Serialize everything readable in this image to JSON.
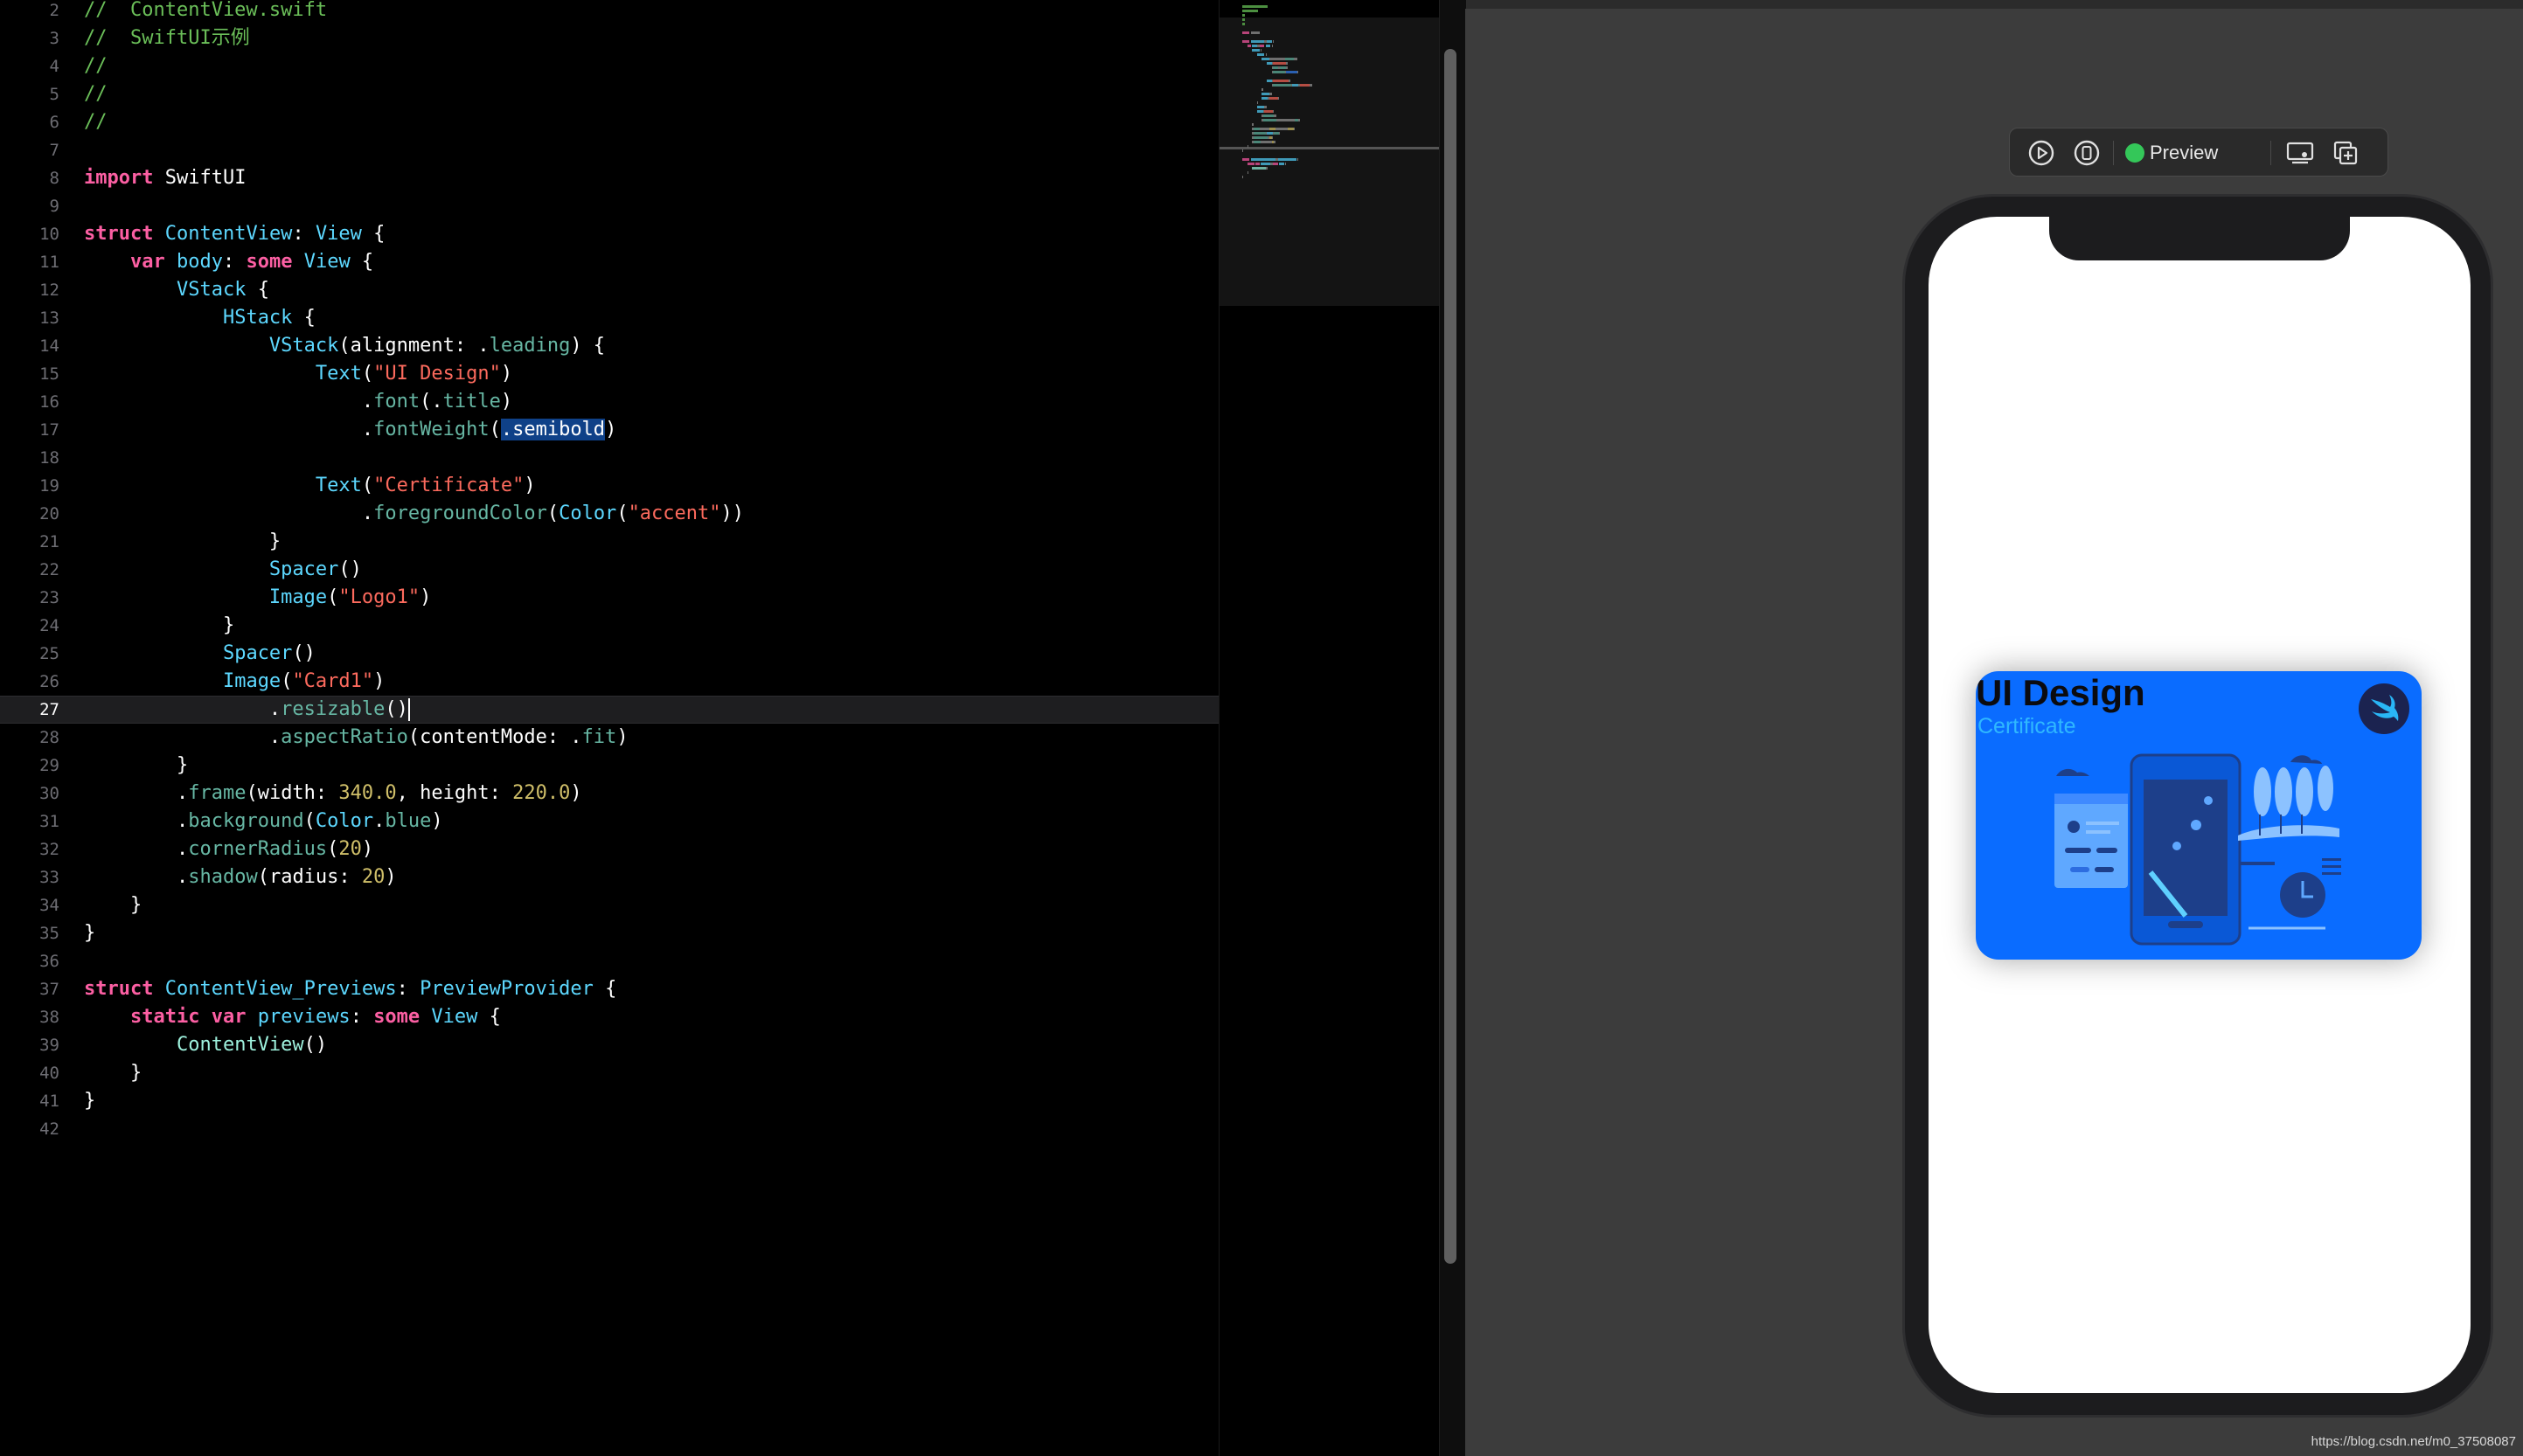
{
  "editor": {
    "current_line": "27",
    "lines": [
      {
        "n": "2",
        "t": [
          {
            "c": "comment",
            "s": "//  ContentView.swift"
          }
        ]
      },
      {
        "n": "3",
        "t": [
          {
            "c": "comment",
            "s": "//  SwiftUI示例"
          }
        ]
      },
      {
        "n": "4",
        "t": [
          {
            "c": "comment",
            "s": "//"
          }
        ]
      },
      {
        "n": "5",
        "t": [
          {
            "c": "comment",
            "s": "//"
          }
        ]
      },
      {
        "n": "6",
        "t": [
          {
            "c": "comment",
            "s": "//"
          }
        ]
      },
      {
        "n": "7",
        "t": []
      },
      {
        "n": "8",
        "t": [
          {
            "c": "keyword",
            "s": "import"
          },
          {
            "c": "plain",
            "s": " SwiftUI"
          }
        ]
      },
      {
        "n": "9",
        "t": []
      },
      {
        "n": "10",
        "t": [
          {
            "c": "keyword",
            "s": "struct"
          },
          {
            "c": "plain",
            "s": " "
          },
          {
            "c": "decl",
            "s": "ContentView"
          },
          {
            "c": "plain",
            "s": ": "
          },
          {
            "c": "type",
            "s": "View"
          },
          {
            "c": "plain",
            "s": " {"
          }
        ]
      },
      {
        "n": "11",
        "t": [
          {
            "c": "plain",
            "s": "    "
          },
          {
            "c": "keyword",
            "s": "var"
          },
          {
            "c": "plain",
            "s": " "
          },
          {
            "c": "decl",
            "s": "body"
          },
          {
            "c": "plain",
            "s": ": "
          },
          {
            "c": "keyword",
            "s": "some"
          },
          {
            "c": "plain",
            "s": " "
          },
          {
            "c": "type",
            "s": "View"
          },
          {
            "c": "plain",
            "s": " {"
          }
        ]
      },
      {
        "n": "12",
        "t": [
          {
            "c": "plain",
            "s": "        "
          },
          {
            "c": "type",
            "s": "VStack"
          },
          {
            "c": "plain",
            "s": " {"
          }
        ]
      },
      {
        "n": "13",
        "t": [
          {
            "c": "plain",
            "s": "            "
          },
          {
            "c": "type",
            "s": "HStack"
          },
          {
            "c": "plain",
            "s": " {"
          }
        ]
      },
      {
        "n": "14",
        "t": [
          {
            "c": "plain",
            "s": "                "
          },
          {
            "c": "type",
            "s": "VStack"
          },
          {
            "c": "plain",
            "s": "(alignment: ."
          },
          {
            "c": "member",
            "s": "leading"
          },
          {
            "c": "plain",
            "s": ") {"
          }
        ]
      },
      {
        "n": "15",
        "t": [
          {
            "c": "plain",
            "s": "                    "
          },
          {
            "c": "type",
            "s": "Text"
          },
          {
            "c": "plain",
            "s": "("
          },
          {
            "c": "string",
            "s": "\"UI Design\""
          },
          {
            "c": "plain",
            "s": ")"
          }
        ]
      },
      {
        "n": "16",
        "t": [
          {
            "c": "plain",
            "s": "                        ."
          },
          {
            "c": "member",
            "s": "font"
          },
          {
            "c": "plain",
            "s": "(."
          },
          {
            "c": "member",
            "s": "title"
          },
          {
            "c": "plain",
            "s": ")"
          }
        ]
      },
      {
        "n": "17",
        "t": [
          {
            "c": "plain",
            "s": "                        ."
          },
          {
            "c": "member",
            "s": "fontWeight"
          },
          {
            "c": "plain",
            "s": "("
          },
          {
            "c": "sel",
            "s": ".semibold"
          },
          {
            "c": "plain",
            "s": ")"
          }
        ]
      },
      {
        "n": "18",
        "t": []
      },
      {
        "n": "19",
        "t": [
          {
            "c": "plain",
            "s": "                    "
          },
          {
            "c": "type",
            "s": "Text"
          },
          {
            "c": "plain",
            "s": "("
          },
          {
            "c": "string",
            "s": "\"Certificate\""
          },
          {
            "c": "plain",
            "s": ")"
          }
        ]
      },
      {
        "n": "20",
        "t": [
          {
            "c": "plain",
            "s": "                        ."
          },
          {
            "c": "member",
            "s": "foregroundColor"
          },
          {
            "c": "plain",
            "s": "("
          },
          {
            "c": "type",
            "s": "Color"
          },
          {
            "c": "plain",
            "s": "("
          },
          {
            "c": "string",
            "s": "\"accent\""
          },
          {
            "c": "plain",
            "s": "))"
          }
        ]
      },
      {
        "n": "21",
        "t": [
          {
            "c": "plain",
            "s": "                }"
          }
        ]
      },
      {
        "n": "22",
        "t": [
          {
            "c": "plain",
            "s": "                "
          },
          {
            "c": "type",
            "s": "Spacer"
          },
          {
            "c": "plain",
            "s": "()"
          }
        ]
      },
      {
        "n": "23",
        "t": [
          {
            "c": "plain",
            "s": "                "
          },
          {
            "c": "type",
            "s": "Image"
          },
          {
            "c": "plain",
            "s": "("
          },
          {
            "c": "string",
            "s": "\"Logo1\""
          },
          {
            "c": "plain",
            "s": ")"
          }
        ]
      },
      {
        "n": "24",
        "t": [
          {
            "c": "plain",
            "s": "            }"
          }
        ]
      },
      {
        "n": "25",
        "t": [
          {
            "c": "plain",
            "s": "            "
          },
          {
            "c": "type",
            "s": "Spacer"
          },
          {
            "c": "plain",
            "s": "()"
          }
        ]
      },
      {
        "n": "26",
        "t": [
          {
            "c": "plain",
            "s": "            "
          },
          {
            "c": "type",
            "s": "Image"
          },
          {
            "c": "plain",
            "s": "("
          },
          {
            "c": "string",
            "s": "\"Card1\""
          },
          {
            "c": "plain",
            "s": ")"
          }
        ]
      },
      {
        "n": "27",
        "t": [
          {
            "c": "plain",
            "s": "                ."
          },
          {
            "c": "member",
            "s": "resizable"
          },
          {
            "c": "plain",
            "s": "()"
          }
        ]
      },
      {
        "n": "28",
        "t": [
          {
            "c": "plain",
            "s": "                ."
          },
          {
            "c": "member",
            "s": "aspectRatio"
          },
          {
            "c": "plain",
            "s": "(contentMode: ."
          },
          {
            "c": "member",
            "s": "fit"
          },
          {
            "c": "plain",
            "s": ")"
          }
        ]
      },
      {
        "n": "29",
        "t": [
          {
            "c": "plain",
            "s": "        }"
          }
        ]
      },
      {
        "n": "30",
        "t": [
          {
            "c": "plain",
            "s": "        ."
          },
          {
            "c": "member",
            "s": "frame"
          },
          {
            "c": "plain",
            "s": "(width: "
          },
          {
            "c": "number",
            "s": "340.0"
          },
          {
            "c": "plain",
            "s": ", height: "
          },
          {
            "c": "number",
            "s": "220.0"
          },
          {
            "c": "plain",
            "s": ")"
          }
        ]
      },
      {
        "n": "31",
        "t": [
          {
            "c": "plain",
            "s": "        ."
          },
          {
            "c": "member",
            "s": "background"
          },
          {
            "c": "plain",
            "s": "("
          },
          {
            "c": "type",
            "s": "Color"
          },
          {
            "c": "plain",
            "s": "."
          },
          {
            "c": "member",
            "s": "blue"
          },
          {
            "c": "plain",
            "s": ")"
          }
        ]
      },
      {
        "n": "32",
        "t": [
          {
            "c": "plain",
            "s": "        ."
          },
          {
            "c": "member",
            "s": "cornerRadius"
          },
          {
            "c": "plain",
            "s": "("
          },
          {
            "c": "number",
            "s": "20"
          },
          {
            "c": "plain",
            "s": ")"
          }
        ]
      },
      {
        "n": "33",
        "t": [
          {
            "c": "plain",
            "s": "        ."
          },
          {
            "c": "member",
            "s": "shadow"
          },
          {
            "c": "plain",
            "s": "(radius: "
          },
          {
            "c": "number",
            "s": "20"
          },
          {
            "c": "plain",
            "s": ")"
          }
        ]
      },
      {
        "n": "34",
        "t": [
          {
            "c": "plain",
            "s": "    }"
          }
        ]
      },
      {
        "n": "35",
        "t": [
          {
            "c": "plain",
            "s": "}"
          }
        ]
      },
      {
        "n": "36",
        "t": []
      },
      {
        "n": "37",
        "t": [
          {
            "c": "keyword",
            "s": "struct"
          },
          {
            "c": "plain",
            "s": " "
          },
          {
            "c": "decl",
            "s": "ContentView_Previews"
          },
          {
            "c": "plain",
            "s": ": "
          },
          {
            "c": "type",
            "s": "PreviewProvider"
          },
          {
            "c": "plain",
            "s": " {"
          }
        ]
      },
      {
        "n": "38",
        "t": [
          {
            "c": "plain",
            "s": "    "
          },
          {
            "c": "keyword",
            "s": "static"
          },
          {
            "c": "plain",
            "s": " "
          },
          {
            "c": "keyword",
            "s": "var"
          },
          {
            "c": "plain",
            "s": " "
          },
          {
            "c": "decl",
            "s": "previews"
          },
          {
            "c": "plain",
            "s": ": "
          },
          {
            "c": "keyword",
            "s": "some"
          },
          {
            "c": "plain",
            "s": " "
          },
          {
            "c": "type",
            "s": "View"
          },
          {
            "c": "plain",
            "s": " {"
          }
        ]
      },
      {
        "n": "39",
        "t": [
          {
            "c": "plain",
            "s": "        "
          },
          {
            "c": "typebright",
            "s": "ContentView"
          },
          {
            "c": "plain",
            "s": "()"
          }
        ]
      },
      {
        "n": "40",
        "t": [
          {
            "c": "plain",
            "s": "    }"
          }
        ]
      },
      {
        "n": "41",
        "t": [
          {
            "c": "plain",
            "s": "}"
          }
        ]
      },
      {
        "n": "42",
        "t": []
      }
    ]
  },
  "preview_toolbar": {
    "live_icon": "play-circle-icon",
    "device_icon": "device-icon",
    "preview_label": "Preview",
    "status_color": "#34c759",
    "device_settings_icon": "device-settings-icon",
    "duplicate_icon": "duplicate-preview-icon"
  },
  "card": {
    "title": "UI Design",
    "subtitle": "Certificate",
    "background_color": "#0a6cff",
    "logo_icon": "swift-logo-icon",
    "illustration_icon": "card-illustration-icon"
  },
  "watermark": "https://blog.csdn.net/m0_37508087"
}
